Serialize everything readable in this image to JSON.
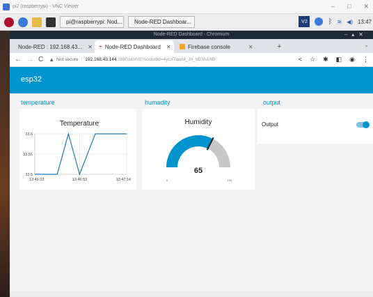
{
  "vnc": {
    "title": "pi2 (raspberrypi) - VNC Viewer"
  },
  "taskbar": {
    "tasks": [
      {
        "label": "pi@raspberrypi: Nod..."
      },
      {
        "label": "Node-RED Dashboar..."
      }
    ],
    "vnc_badge": "V2",
    "clock": "13:47"
  },
  "chrome": {
    "window_title": "Node-RED Dashboard - Chromium",
    "tabs": [
      {
        "label": "Node-RED : 192.168.43...",
        "active": false
      },
      {
        "label": "Node-RED Dashboard",
        "active": true
      },
      {
        "label": "Firebase console",
        "active": false
      }
    ],
    "omnibox": {
      "security": "Not secure",
      "host": "192.168.43.144",
      "path": ":1880/ui/#!/0?socketid=4ycXTqwM_Jh_sE0AAAB"
    }
  },
  "dashboard": {
    "title": "esp32",
    "groups": {
      "temperature": "temperature",
      "humidity": "humadity",
      "output": "output"
    },
    "temperature_chart": {
      "title": "Temperature"
    },
    "humidity_gauge": {
      "title": "Humidity",
      "value": 65,
      "min": 0,
      "max": 100,
      "color": "#0094ce"
    },
    "output_switch": {
      "label": "Output",
      "on": true
    }
  },
  "chart_data": {
    "type": "line",
    "title": "Temperature",
    "x": [
      "13:46:33",
      "13:46:43",
      "13:46:48",
      "13:46:53",
      "13:47:00",
      "13:47:14"
    ],
    "x_ticks": [
      "13:46:33",
      "13:46:53",
      "13:47:14"
    ],
    "y_ticks": [
      "33.6",
      "33.55",
      "33.5"
    ],
    "series": [
      {
        "values": [
          33.5,
          33.5,
          33.6,
          33.5,
          33.6,
          33.6
        ]
      }
    ],
    "ylim": [
      33.5,
      33.6
    ],
    "grid": true,
    "color": "#1f77b4"
  }
}
